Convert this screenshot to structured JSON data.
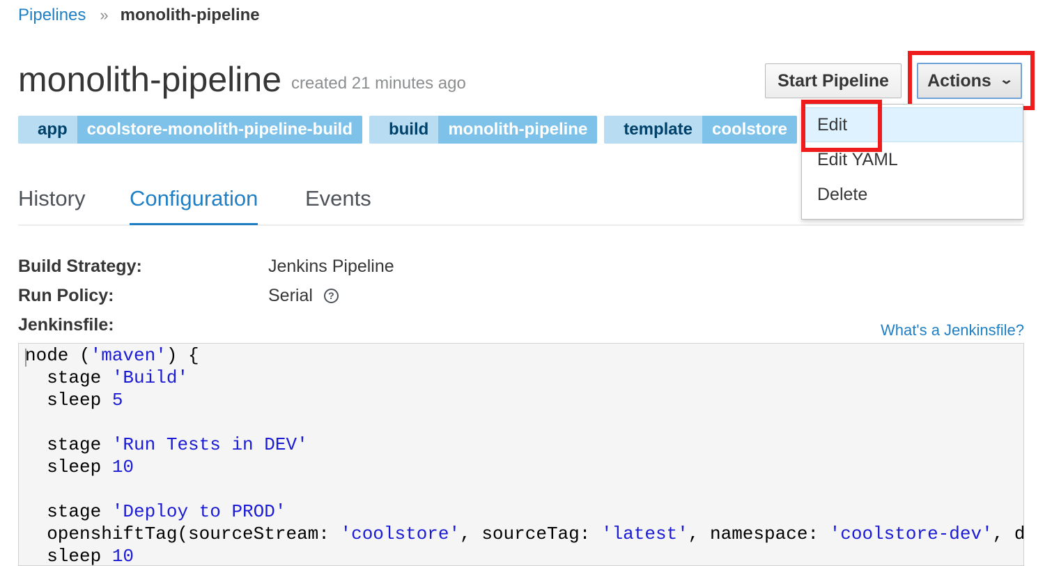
{
  "breadcrumb": {
    "root": "Pipelines",
    "separator": "»",
    "current": "monolith-pipeline"
  },
  "header": {
    "title": "monolith-pipeline",
    "created": "created 21 minutes ago",
    "start_button": "Start Pipeline",
    "actions_button": "Actions"
  },
  "labels": [
    {
      "key": "app",
      "value": "coolstore-monolith-pipeline-build"
    },
    {
      "key": "build",
      "value": "monolith-pipeline"
    },
    {
      "key": "template",
      "value": "coolstore"
    }
  ],
  "actions_menu": {
    "items": [
      "Edit",
      "Edit YAML",
      "Delete"
    ],
    "active": "Edit"
  },
  "tabs": [
    {
      "label": "History",
      "active": false
    },
    {
      "label": "Configuration",
      "active": true
    },
    {
      "label": "Events",
      "active": false
    }
  ],
  "config": {
    "build_strategy_label": "Build Strategy:",
    "build_strategy_value": "Jenkins Pipeline",
    "run_policy_label": "Run Policy:",
    "run_policy_value": "Serial",
    "jenkinsfile_label": "Jenkinsfile:",
    "jenkinsfile_help": "What's a Jenkinsfile?"
  },
  "jenkinsfile_lines": [
    "node ('maven') {",
    "  stage 'Build'",
    "  sleep 5",
    "",
    "  stage 'Run Tests in DEV'",
    "  sleep 10",
    "",
    "  stage 'Deploy to PROD'",
    "  openshiftTag(sourceStream: 'coolstore', sourceTag: 'latest', namespace: 'coolstore-dev', destinati",
    "  sleep 10"
  ],
  "colors": {
    "link": "#1f7fc4",
    "highlight": "#ee1c1c",
    "label_key_bg": "#b8dcf1",
    "label_value_bg": "#7ec2e9",
    "code_string": "#1b1bd6"
  },
  "icons": {
    "help": "question-circle-icon",
    "actions_caret": "chevron-down-icon"
  }
}
